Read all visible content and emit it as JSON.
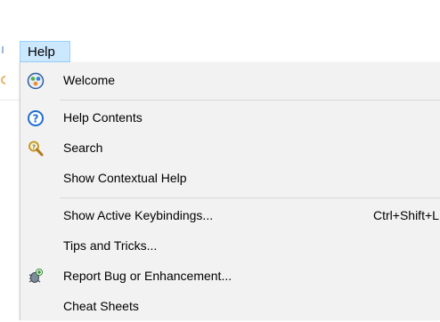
{
  "menu": {
    "title": "Help",
    "items": [
      {
        "label": "Welcome",
        "icon": "welcome-icon"
      },
      {
        "label": "Help Contents",
        "icon": "help-question-icon"
      },
      {
        "label": "Search",
        "icon": "search-help-icon"
      },
      {
        "label": "Show Contextual Help"
      },
      {
        "label": "Show Active Keybindings...",
        "shortcut": "Ctrl+Shift+L"
      },
      {
        "label": "Tips and Tricks..."
      },
      {
        "label": "Report Bug or Enhancement...",
        "icon": "bug-report-icon"
      },
      {
        "label": "Cheat Sheets"
      }
    ]
  },
  "colors": {
    "menu_title_highlight": "#cce8ff",
    "menu_title_border": "#99d1ff",
    "dropdown_background": "#f2f2f2",
    "help_icon_blue": "#1f6fd1"
  }
}
